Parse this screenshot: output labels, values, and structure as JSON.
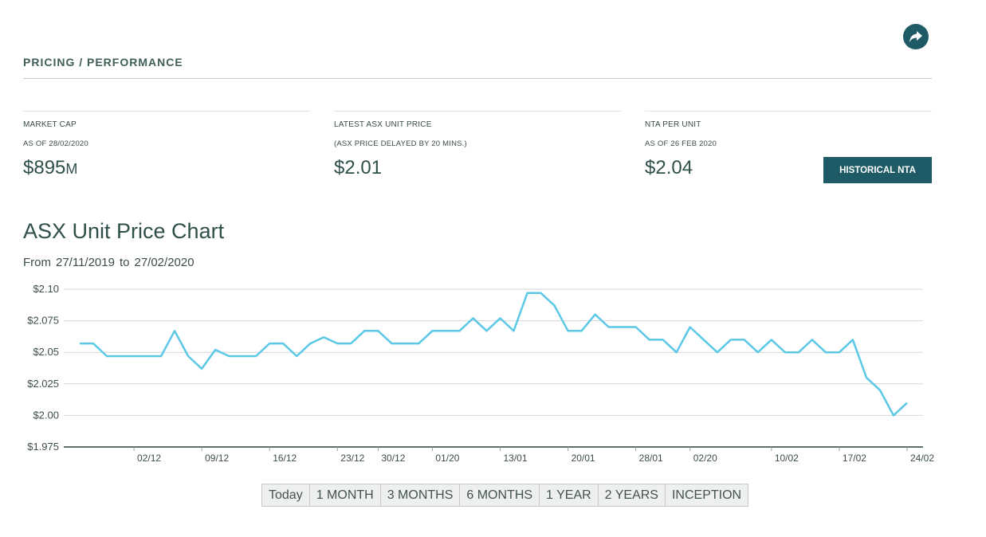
{
  "header": {
    "section_title": "PRICING / PERFORMANCE",
    "share_icon": "share-arrow-icon"
  },
  "stats": [
    {
      "label": "MARKET CAP",
      "sublabel": "AS OF 28/02/2020",
      "value": "$895",
      "suffix": "M"
    },
    {
      "label": "LATEST ASX UNIT PRICE",
      "sublabel": "(ASX PRICE DELAYED BY 20 MINS.)",
      "value": "$2.01",
      "suffix": ""
    },
    {
      "label": "NTA PER UNIT",
      "sublabel": "AS OF 26 FEB 2020",
      "value": "$2.04",
      "suffix": ""
    }
  ],
  "nta_button": "HISTORICAL NTA",
  "chart_section": {
    "title": "ASX Unit Price Chart",
    "range_from_label": "From",
    "range_from": "27/11/2019",
    "range_to_label": "to",
    "range_to": "27/02/2020"
  },
  "colors": {
    "accent": "#1f5b66",
    "line": "#5bc8e6",
    "text": "#2f4f4a"
  },
  "chart_data": {
    "type": "line",
    "title": "ASX Unit Price Chart",
    "ylim": [
      1.975,
      2.1
    ],
    "y_ticks": [
      {
        "value": 2.1,
        "label": "$2.10"
      },
      {
        "value": 2.075,
        "label": "$2.075"
      },
      {
        "value": 2.05,
        "label": "$2.05"
      },
      {
        "value": 2.025,
        "label": "$2.025"
      },
      {
        "value": 2.0,
        "label": "$2.00"
      },
      {
        "value": 1.975,
        "label": "$1.975"
      }
    ],
    "x_ticks": [
      {
        "index": 4,
        "label": "02/12"
      },
      {
        "index": 9,
        "label": "09/12"
      },
      {
        "index": 14,
        "label": "16/12"
      },
      {
        "index": 19,
        "label": "23/12"
      },
      {
        "index": 22,
        "label": "30/12"
      },
      {
        "index": 26,
        "label": "01/20"
      },
      {
        "index": 31,
        "label": "13/01"
      },
      {
        "index": 36,
        "label": "20/01"
      },
      {
        "index": 41,
        "label": "28/01"
      },
      {
        "index": 45,
        "label": "02/20"
      },
      {
        "index": 51,
        "label": "10/02"
      },
      {
        "index": 56,
        "label": "17/02"
      },
      {
        "index": 61,
        "label": "24/02"
      }
    ],
    "grid": true,
    "series": [
      {
        "values": [
          2.057,
          2.057,
          2.047,
          2.047,
          2.047,
          2.047,
          2.047,
          2.067,
          2.047,
          2.037,
          2.052,
          2.047,
          2.047,
          2.047,
          2.057,
          2.057,
          2.047,
          2.057,
          2.062,
          2.057,
          2.057,
          2.067,
          2.067,
          2.057,
          2.057,
          2.057,
          2.067,
          2.067,
          2.067,
          2.077,
          2.067,
          2.077,
          2.067,
          2.097,
          2.097,
          2.087,
          2.067,
          2.067,
          2.08,
          2.07,
          2.07,
          2.07,
          2.06,
          2.06,
          2.05,
          2.07,
          2.06,
          2.05,
          2.06,
          2.06,
          2.05,
          2.06,
          2.05,
          2.05,
          2.06,
          2.05,
          2.05,
          2.06,
          2.03,
          2.02,
          2.0,
          2.01
        ]
      }
    ]
  },
  "range_buttons": [
    "Today",
    "1 MONTH",
    "3 MONTHS",
    "6 MONTHS",
    "1 YEAR",
    "2 YEARS",
    "INCEPTION"
  ]
}
